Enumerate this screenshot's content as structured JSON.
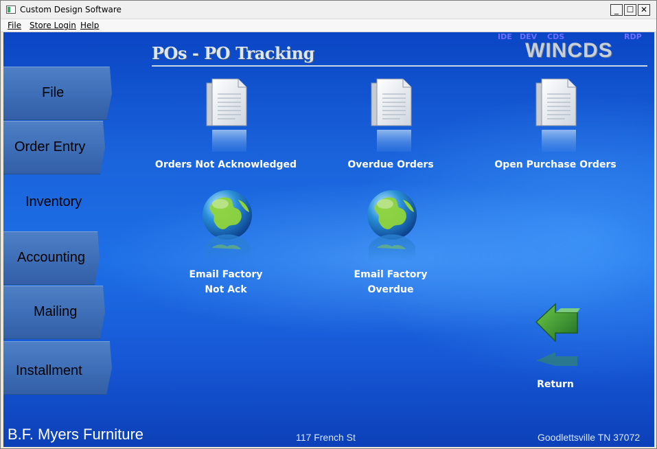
{
  "window": {
    "title": "Custom Design Software",
    "controls": [
      "_",
      "☐",
      "✕"
    ]
  },
  "menubar": {
    "items": [
      {
        "label": "File"
      },
      {
        "label": "Store Login"
      },
      {
        "label": "Help"
      }
    ]
  },
  "header": {
    "title": "POs - PO Tracking",
    "tags": {
      "ide": "IDE",
      "dev": "DEV",
      "cds": "CDS",
      "rdp": "RDP"
    },
    "logo": "WINCDS"
  },
  "sidebar": {
    "items": [
      {
        "label": "File",
        "active": false
      },
      {
        "label": "Order Entry",
        "active": false
      },
      {
        "label": "Inventory",
        "active": true
      },
      {
        "label": "Accounting",
        "active": false
      },
      {
        "label": "Mailing",
        "active": false
      },
      {
        "label": "Installment",
        "active": false
      }
    ]
  },
  "tiles": [
    {
      "label": "Orders Not Acknowledged",
      "icon": "document-icon"
    },
    {
      "label": "Overdue Orders",
      "icon": "document-icon"
    },
    {
      "label": "Open Purchase Orders",
      "icon": "document-icon"
    },
    {
      "label_line1": "Email Factory",
      "label_line2": "Not Ack",
      "icon": "globe-icon"
    },
    {
      "label_line1": "Email Factory",
      "label_line2": "Overdue",
      "icon": "globe-icon"
    },
    {
      "label": "Return",
      "icon": "back-arrow-icon"
    }
  ],
  "footer": {
    "store_name": "B.F. Myers Furniture",
    "address": "117 French St",
    "city": "Goodlettsville TN 37072"
  },
  "colors": {
    "background": "#1a63db",
    "nav_button": "#3e6fb8",
    "tag": "#6f6fff",
    "label": "#ffffff"
  }
}
